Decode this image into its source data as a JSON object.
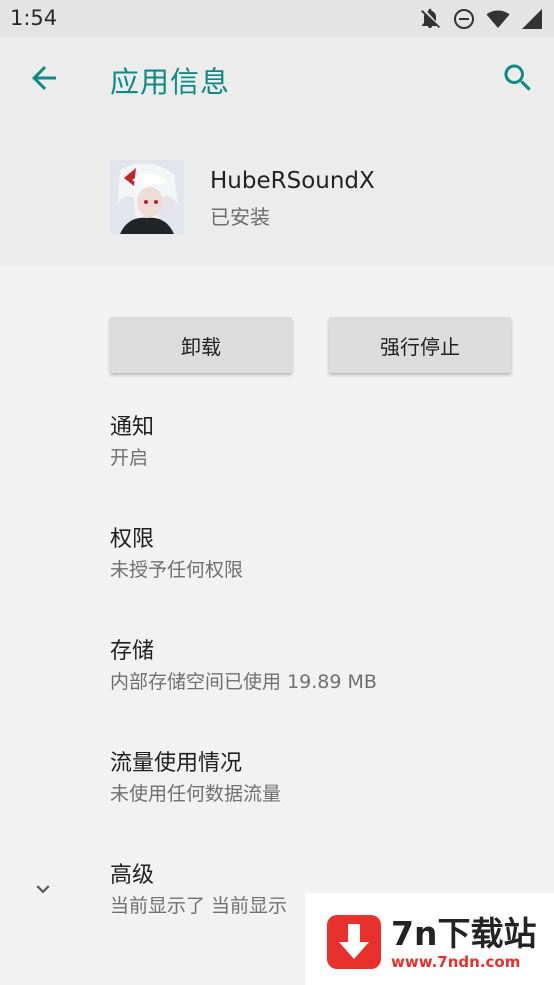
{
  "status_bar": {
    "time": "1:54",
    "icons": [
      "notifications-off-icon",
      "do-not-disturb-icon",
      "wifi-icon",
      "cellular-signal-icon"
    ]
  },
  "header": {
    "back_icon": "arrow-back-icon",
    "title": "应用信息",
    "search_icon": "search-icon"
  },
  "app": {
    "name": "HubeRSoundX",
    "status": "已安装"
  },
  "actions": {
    "uninstall": "卸载",
    "force_stop": "强行停止"
  },
  "items": [
    {
      "title": "通知",
      "subtitle": "开启"
    },
    {
      "title": "权限",
      "subtitle": "未授予任何权限"
    },
    {
      "title": "存储",
      "subtitle": "内部存储空间已使用 19.89 MB"
    },
    {
      "title": "流量使用情况",
      "subtitle": "未使用任何数据流量"
    },
    {
      "title": "高级",
      "subtitle": "当前显示了 当前显示"
    }
  ],
  "watermark": {
    "title": "7n下载站",
    "url": "www.7ndn.com"
  },
  "colors": {
    "accent": "#0d8a84",
    "watermark_red": "#e8312d"
  }
}
